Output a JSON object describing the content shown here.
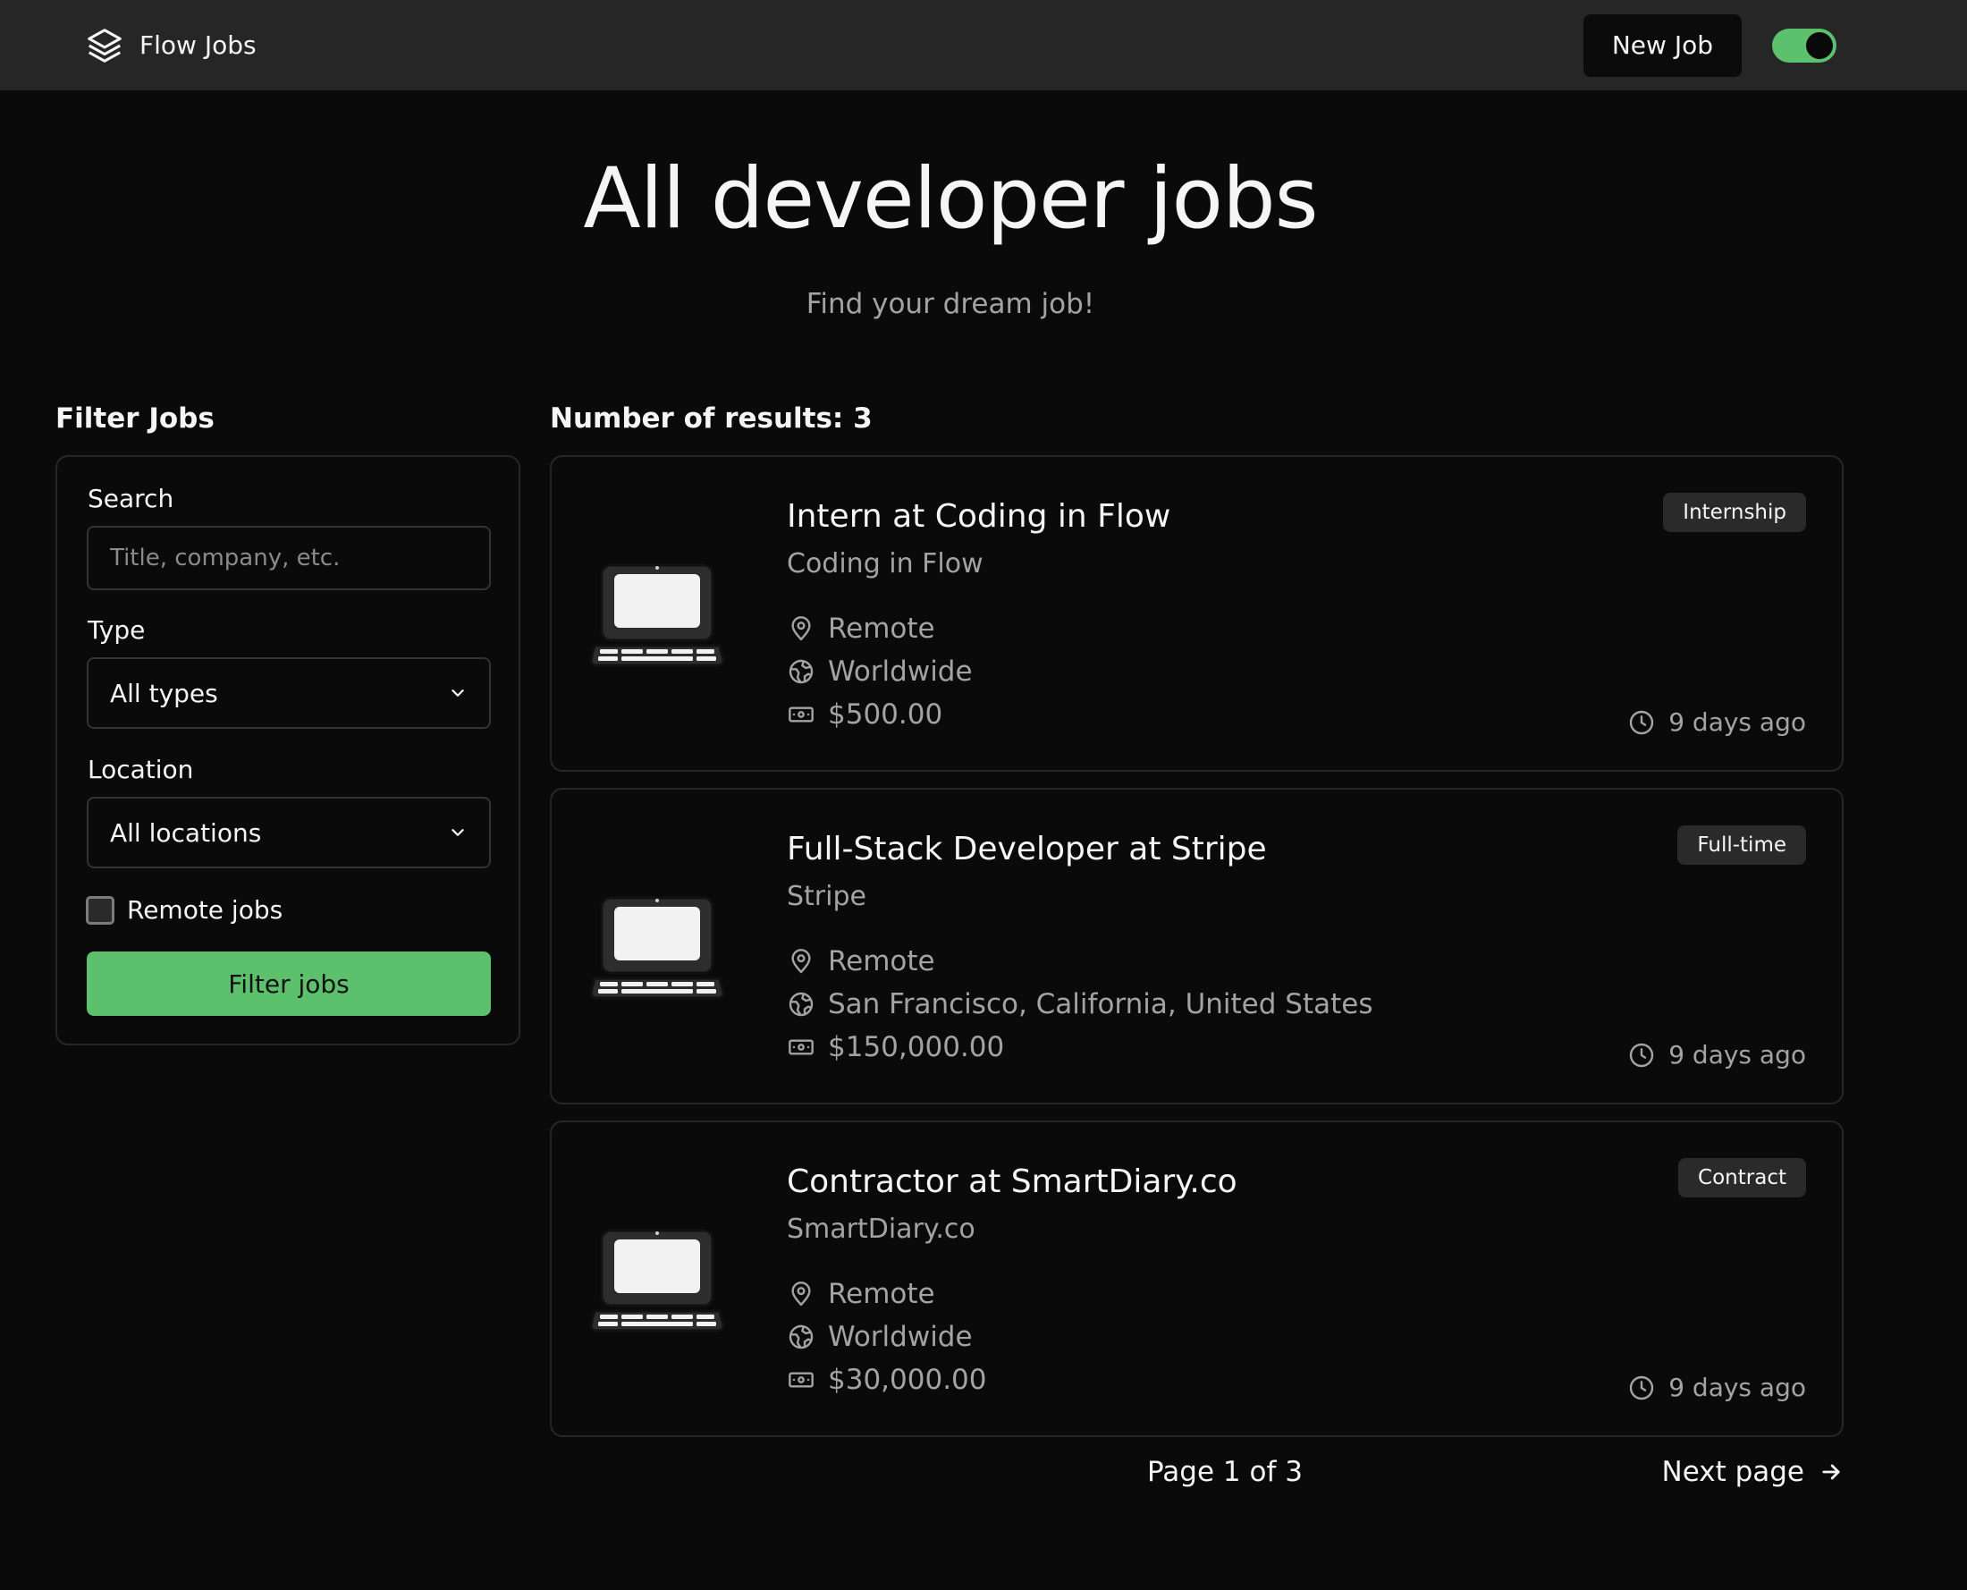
{
  "header": {
    "brand_name": "Flow Jobs",
    "brand_icon": "stack-layers-icon",
    "new_job_label": "New Job",
    "theme_toggle": {
      "on": true,
      "color": "#5cc06c"
    }
  },
  "hero": {
    "title": "All developer jobs",
    "subtitle": "Find your dream job!"
  },
  "filter": {
    "heading": "Filter Jobs",
    "search_label": "Search",
    "search_placeholder": "Title, company, etc.",
    "search_value": "",
    "type_label": "Type",
    "type_selected": "All types",
    "location_label": "Location",
    "location_selected": "All locations",
    "remote_label": "Remote jobs",
    "remote_checked": false,
    "submit_label": "Filter jobs",
    "accent": "#5cc06c"
  },
  "results": {
    "count_label": "Number of results: 3",
    "jobs": [
      {
        "title": "Intern at Coding in Flow",
        "company": "Coding in Flow",
        "location_type": "Remote",
        "location": "Worldwide",
        "salary": "$500.00",
        "badge": "Internship",
        "posted": "9 days ago",
        "logo_icon": "laptop-icon"
      },
      {
        "title": "Full-Stack Developer at Stripe",
        "company": "Stripe",
        "location_type": "Remote",
        "location": "San Francisco, California, United States",
        "salary": "$150,000.00",
        "badge": "Full-time",
        "posted": "9 days ago",
        "logo_icon": "laptop-icon"
      },
      {
        "title": "Contractor at SmartDiary.co",
        "company": "SmartDiary.co",
        "location_type": "Remote",
        "location": "Worldwide",
        "salary": "$30,000.00",
        "badge": "Contract",
        "posted": "9 days ago",
        "logo_icon": "laptop-icon"
      }
    ]
  },
  "pagination": {
    "page_label": "Page 1 of 3",
    "next_label": "Next page"
  }
}
